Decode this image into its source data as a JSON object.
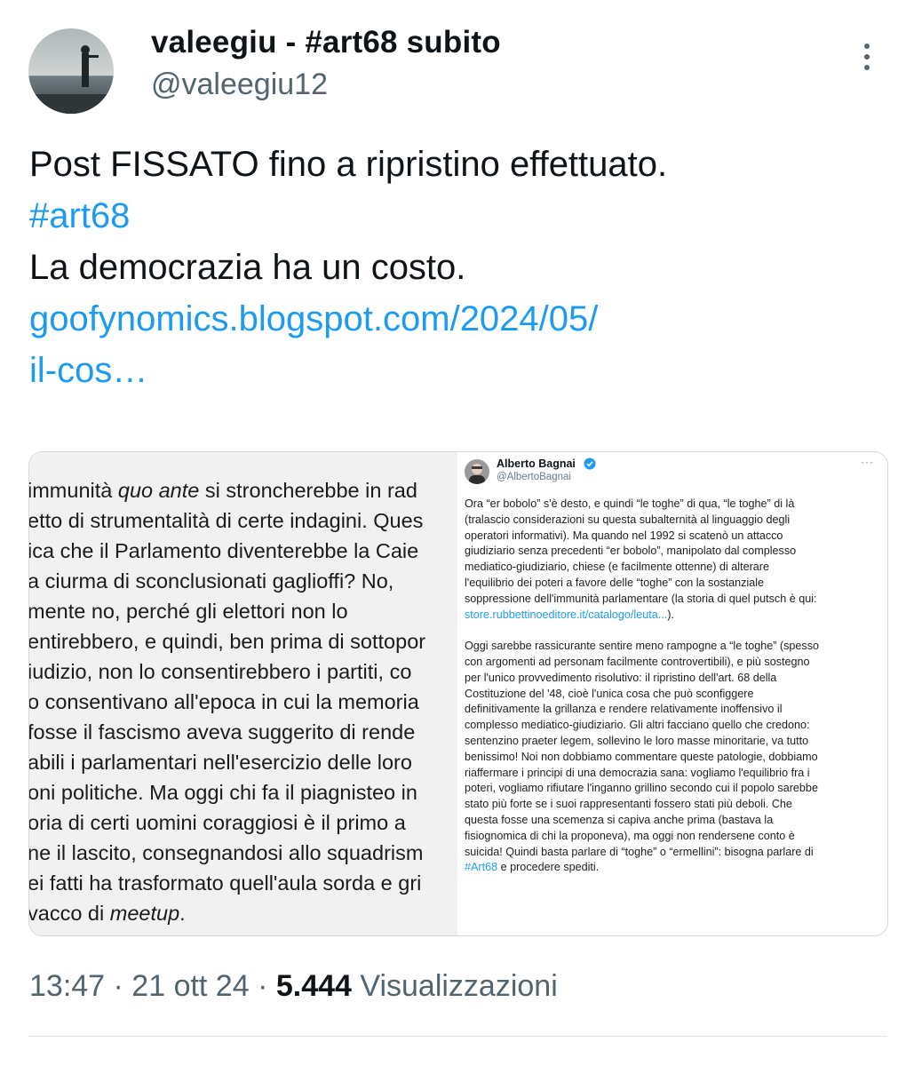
{
  "author": {
    "display_name": "valeegiu - #art68 subito",
    "handle": "@valeegiu12",
    "avatar_icon": "profile-photo-person-on-shore"
  },
  "tweet": {
    "lines": [
      {
        "text": "Post FISSATO fino a ripristino effettuato.",
        "type": "text"
      },
      {
        "text": "#art68",
        "type": "hashtag"
      },
      {
        "text": "La democrazia ha un costo.",
        "type": "text"
      },
      {
        "text": "goofynomics.blogspot.com/2024/05/",
        "type": "link"
      },
      {
        "text": "il-cos…",
        "type": "link"
      }
    ],
    "link_color": "#1d9bf0"
  },
  "media_left": {
    "lines": [
      [
        "immunità ",
        "quo ante",
        " si stroncherebbe in rad"
      ],
      [
        "etto di strumentalità di certe indagini. Ques"
      ],
      [
        "ica che il Parlamento diventerebbe la Caie"
      ],
      [
        "a ciurma di sconclusionati gaglioffi? No,"
      ],
      [
        "mente no, perché gli elettori non lo"
      ],
      [
        "entirebbero, e quindi, ben prima di sottopor"
      ],
      [
        "iudizio, non lo consentirebbero i partiti, co"
      ],
      [
        "o consentivano all'epoca in cui la memoria"
      ],
      [
        "fosse il fascismo aveva suggerito di rende"
      ],
      [
        "abili i parlamentari nell'esercizio delle loro"
      ],
      [
        "oni politiche. Ma oggi chi fa il piagnisteo in"
      ],
      [
        "oria di certi uomini coraggiosi è il primo a"
      ],
      [
        "ne il lascito, consegnandosi allo squadrism"
      ],
      [
        "ei fatti ha trasformato quell'aula sorda e gri"
      ],
      [
        "vacco di ",
        "meetup",
        "."
      ]
    ]
  },
  "media_right": {
    "name": "Alberto Bagnai",
    "handle": "@AlbertoBagnai",
    "more": "···",
    "para1": [
      "Ora “er bobolo” s'è desto, e quindi “le toghe” di qua, “le toghe” di là",
      "(tralascio considerazioni su questa subalternità al linguaggio degli",
      "operatori informativi). Ma quando nel 1992 si scatenò un attacco",
      "giudiziario senza precedenti “er bobolo”, manipolato dal complesso",
      "mediatico-giudiziario, chiese (e facilmente ottenne) di alterare",
      "l'equilibrio dei poteri a favore delle “toghe” con la sostanziale",
      "soppressione dell'immunità parlamentare (la storia di quel putsch è qui:"
    ],
    "para1_link": "store.rubbettinoeditore.it/catalogo/leuta...",
    "para1_link_tail": ").",
    "para2": [
      "Oggi sarebbe rassicurante sentire meno rampogne a “le toghe” (spesso",
      "con argomenti ad personam facilmente controvertibili), e più sostegno",
      "per l'unico provvedimento risolutivo: il ripristino dell'art. 68 della",
      "Costituzione del '48, cioè l'unica cosa che può sconfiggere",
      "definitivamente la grillanza e rendere relativamente inoffensivo il",
      "complesso mediatico-giudiziario. Gli altri facciano quello che credono:",
      "sentenzino praeter legem, sollevino le loro masse minoritarie, va tutto",
      "benissimo! Noi non dobbiamo commentare queste patologie, dobbiamo",
      "riaffermare i principi di una democrazia sana: vogliamo l'equilibrio fra i",
      "poteri, vogliamo rifiutare l'inganno grillino secondo cui il popolo sarebbe",
      "stato più forte se i suoi rappresentanti fossero stati più deboli. Che",
      "questa fosse una scemenza si capiva anche prima (bastava la",
      "fisiognomica di chi la proponeva), ma oggi non rendersene conto è",
      "suicida! Quindi basta parlare di “toghe” o “ermellini”: bisogna parlare di"
    ],
    "para2_hashtag": "#Art68",
    "para2_tail": " e procedere spediti."
  },
  "meta": {
    "time": "13:47 · 21 ott 24 · ",
    "views_count": "5.444",
    "views_label": " Visualizzazioni"
  }
}
